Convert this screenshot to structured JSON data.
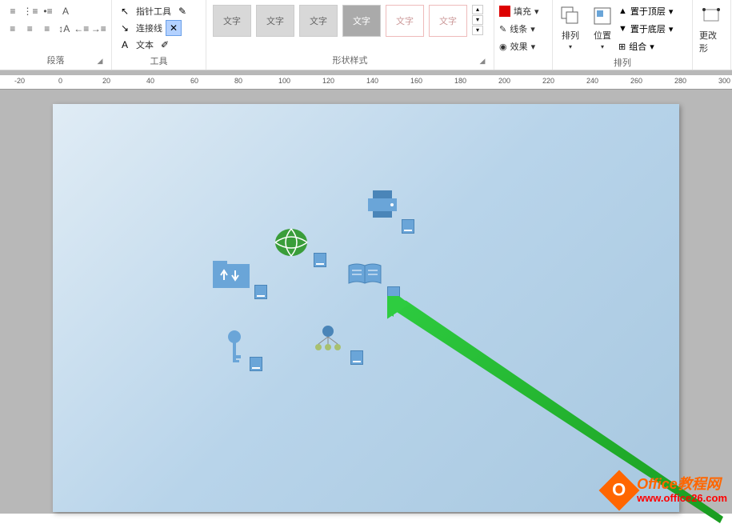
{
  "ribbon": {
    "groups": {
      "paragraph": {
        "label": "段落"
      },
      "tools": {
        "label": "工具",
        "pointer": "指针工具",
        "connector": "连接线",
        "text": "文本"
      },
      "shape_styles": {
        "label": "形状样式",
        "preset_label": "文字"
      },
      "fill": {
        "fill": "填充",
        "line": "线条",
        "effect": "效果"
      },
      "arrange": {
        "label": "排列",
        "arrange_btn": "排列",
        "position_btn": "位置",
        "bring_front": "置于顶层",
        "send_back": "置于底层",
        "group": "组合"
      },
      "editshape": {
        "label": "更改形"
      }
    }
  },
  "ruler": {
    "ticks": [
      "-20",
      "0",
      "20",
      "40",
      "60",
      "80",
      "100",
      "120",
      "140",
      "160",
      "180",
      "200",
      "220",
      "240",
      "260",
      "280",
      "300"
    ]
  },
  "watermark": {
    "title": "Office教程网",
    "url": "www.office26.com",
    "logo_letter": "O"
  },
  "chart_data": null
}
